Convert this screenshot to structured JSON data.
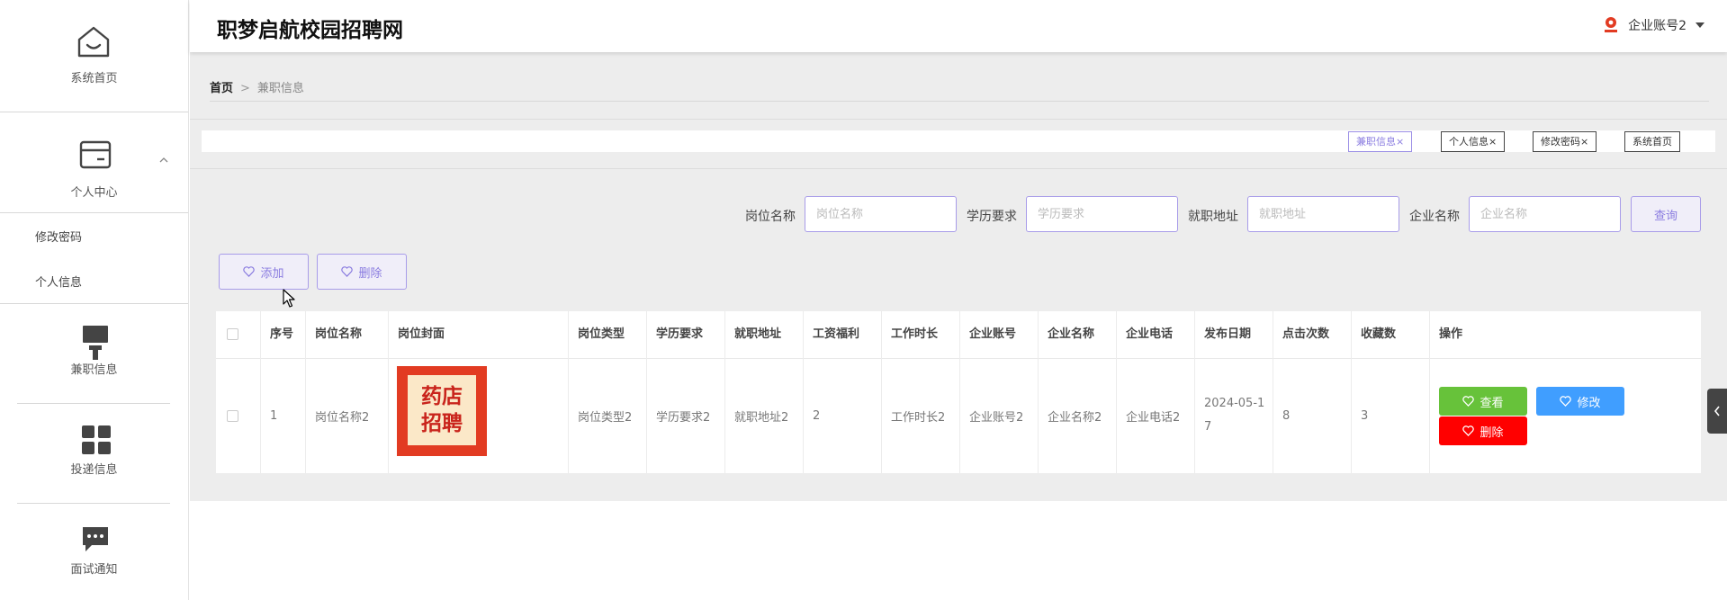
{
  "app": {
    "title": "职梦启航校园招聘网"
  },
  "header": {
    "user_label": "企业账号2"
  },
  "sidebar": {
    "home": "系统首页",
    "personal_center": "个人中心",
    "sub_items": [
      "修改密码",
      "个人信息"
    ],
    "parttime": "兼职信息",
    "delivery": "投递信息",
    "interview": "面试通知"
  },
  "breadcrumb": {
    "home": "首页",
    "separator": ">",
    "current": "兼职信息"
  },
  "tabs": [
    {
      "label": "兼职信息",
      "active": true
    },
    {
      "label": "个人信息",
      "active": false
    },
    {
      "label": "修改密码",
      "active": false
    },
    {
      "label": "系统首页",
      "active": false
    }
  ],
  "tab_close": "×",
  "search": {
    "fields": [
      {
        "label": "岗位名称",
        "placeholder": "岗位名称"
      },
      {
        "label": "学历要求",
        "placeholder": "学历要求"
      },
      {
        "label": "就职地址",
        "placeholder": "就职地址"
      },
      {
        "label": "企业名称",
        "placeholder": "企业名称"
      }
    ],
    "query_label": "查询"
  },
  "toolbar": {
    "add_label": "添加",
    "delete_label": "删除"
  },
  "table": {
    "headers": [
      "序号",
      "岗位名称",
      "岗位封面",
      "岗位类型",
      "学历要求",
      "就职地址",
      "工资福利",
      "工作时长",
      "企业账号",
      "企业名称",
      "企业电话",
      "发布日期",
      "点击次数",
      "收藏数",
      "操作"
    ],
    "rows": [
      {
        "index": "1",
        "job_name": "岗位名称2",
        "cover_text": [
          "药店",
          "招聘"
        ],
        "job_type": "岗位类型2",
        "education": "学历要求2",
        "address": "就职地址2",
        "salary": "2",
        "work_hours": "工作时长2",
        "company_account": "企业账号2",
        "company_name": "企业名称2",
        "company_phone": "企业电话2",
        "publish_date": "2024-05-17",
        "clicks": "8",
        "favorites": "3"
      }
    ],
    "actions": {
      "view": "查看",
      "edit": "修改",
      "delete": "删除"
    }
  },
  "colors": {
    "accent": "#8a7ce0",
    "view_button": "#67c23a",
    "edit_button": "#409eff",
    "delete_button": "#ff0000"
  }
}
